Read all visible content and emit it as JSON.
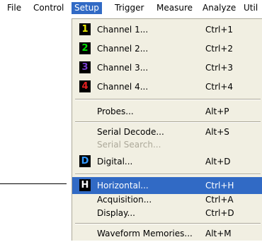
{
  "menubar": {
    "items": [
      {
        "label": "File"
      },
      {
        "label": "Control"
      },
      {
        "label": "Setup"
      },
      {
        "label": "Trigger"
      },
      {
        "label": "Measure"
      },
      {
        "label": "Analyze"
      },
      {
        "label": "Util"
      }
    ],
    "active_index": 2
  },
  "dropdown": {
    "items": [
      {
        "label": "Channel 1...",
        "shortcut": "Ctrl+1",
        "icon": "1",
        "icon_color": "#e8e800",
        "icon_name": "channel-1-icon"
      },
      {
        "label": "Channel 2...",
        "shortcut": "Ctrl+2",
        "icon": "2",
        "icon_color": "#00e000",
        "icon_name": "channel-2-icon"
      },
      {
        "label": "Channel 3...",
        "shortcut": "Ctrl+3",
        "icon": "3",
        "icon_color": "#7a3fd0",
        "icon_name": "channel-3-icon"
      },
      {
        "label": "Channel 4...",
        "shortcut": "Ctrl+4",
        "icon": "4",
        "icon_color": "#e52020",
        "icon_name": "channel-4-icon"
      },
      {
        "label": "Probes...",
        "shortcut": "Alt+P"
      },
      {
        "label": "Serial Decode...",
        "shortcut": "Alt+S"
      },
      {
        "label": "Serial Search...",
        "shortcut": "",
        "disabled": true
      },
      {
        "label": "Digital...",
        "shortcut": "Alt+D",
        "icon": "D",
        "icon_color": "#3399ff",
        "icon_name": "digital-icon"
      },
      {
        "label": "Horizontal...",
        "shortcut": "Ctrl+H",
        "icon": "H",
        "icon_color": "#ffffff",
        "icon_name": "horizontal-icon",
        "highlighted": true
      },
      {
        "label": "Acquisition...",
        "shortcut": "Ctrl+A"
      },
      {
        "label": "Display...",
        "shortcut": "Ctrl+D"
      },
      {
        "label": "Waveform Memories...",
        "shortcut": "Alt+M"
      }
    ]
  },
  "colors": {
    "menu_background": "#f1efe2",
    "highlight": "#316ac5",
    "disabled_text": "#aca899"
  }
}
